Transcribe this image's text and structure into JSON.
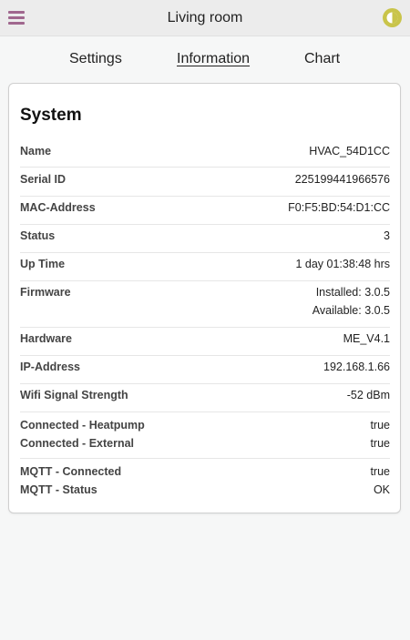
{
  "header": {
    "title": "Living room",
    "menu_icon": "hamburger-menu-icon",
    "theme_icon": "contrast-icon",
    "accent_menu": "#a0678e",
    "accent_theme": "#c9c44a"
  },
  "tabs": [
    {
      "label": "Settings",
      "active": false
    },
    {
      "label": "Information",
      "active": true
    },
    {
      "label": "Chart",
      "active": false
    }
  ],
  "system": {
    "title": "System",
    "rows": {
      "name": {
        "label": "Name",
        "value": "HVAC_54D1CC"
      },
      "serial": {
        "label": "Serial ID",
        "value": "225199441966576"
      },
      "mac": {
        "label": "MAC-Address",
        "value": "F0:F5:BD:54:D1:CC"
      },
      "status": {
        "label": "Status",
        "value": "3"
      },
      "uptime": {
        "label": "Up Time",
        "value": "1 day 01:38:48 hrs"
      },
      "firmware": {
        "label": "Firmware",
        "installed": "Installed: 3.0.5",
        "available": "Available: 3.0.5"
      },
      "hardware": {
        "label": "Hardware",
        "value": "ME_V4.1"
      },
      "ip": {
        "label": "IP-Address",
        "value": "192.168.1.66"
      },
      "wifi": {
        "label": "Wifi Signal Strength",
        "value": "-52 dBm"
      },
      "conn_heatpump": {
        "label": "Connected - Heatpump",
        "value": "true"
      },
      "conn_external": {
        "label": "Connected - External",
        "value": "true"
      },
      "mqtt_connected": {
        "label": "MQTT - Connected",
        "value": "true"
      },
      "mqtt_status": {
        "label": "MQTT - Status",
        "value": "OK"
      }
    }
  }
}
